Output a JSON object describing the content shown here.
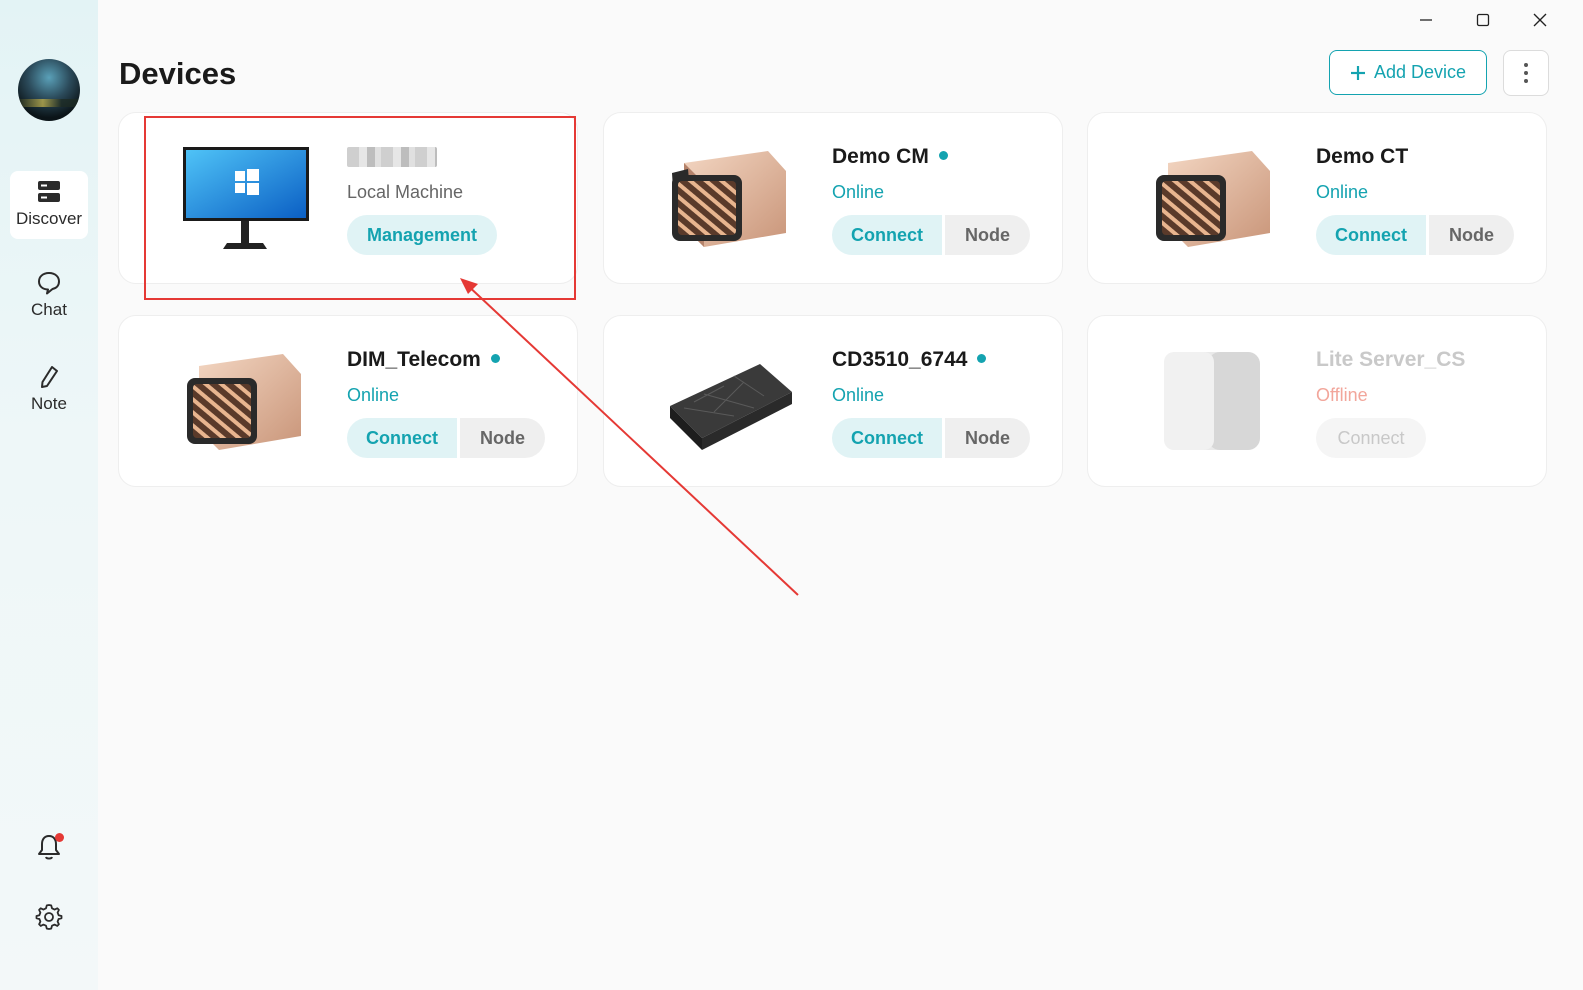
{
  "window": {
    "minimize_icon": "minimize-icon",
    "maximize_icon": "maximize-icon",
    "close_icon": "close-icon"
  },
  "sidebar": {
    "items": [
      {
        "label": "Discover",
        "icon": "server-icon",
        "active": true
      },
      {
        "label": "Chat",
        "icon": "chat-bubble-icon",
        "active": false
      },
      {
        "label": "Note",
        "icon": "pen-icon",
        "active": false
      }
    ],
    "bottom_icons": [
      "bell-icon",
      "gear-icon"
    ]
  },
  "header": {
    "title": "Devices",
    "add_device_label": "Add Device"
  },
  "devices": [
    {
      "name": "",
      "subtitle": "Local Machine",
      "action": "Management",
      "type": "pc"
    },
    {
      "name": "Demo CM",
      "status": "Online",
      "connect": "Connect",
      "node": "Node",
      "type": "nas-gold"
    },
    {
      "name": "Demo CT",
      "status": "Online",
      "connect": "Connect",
      "node": "Node",
      "type": "nas-gold"
    },
    {
      "name": "DIM_Telecom",
      "status": "Online",
      "connect": "Connect",
      "node": "Node",
      "type": "nas-gold"
    },
    {
      "name": "CD3510_6744",
      "status": "Online",
      "connect": "Connect",
      "node": "Node",
      "type": "nas-black"
    },
    {
      "name": "Lite Server_CS",
      "status": "Offline",
      "connect": "Connect",
      "type": "nas-white"
    }
  ],
  "colors": {
    "accent": "#14a3b0",
    "annotation": "#e53935",
    "offline": "#f2a69b"
  }
}
